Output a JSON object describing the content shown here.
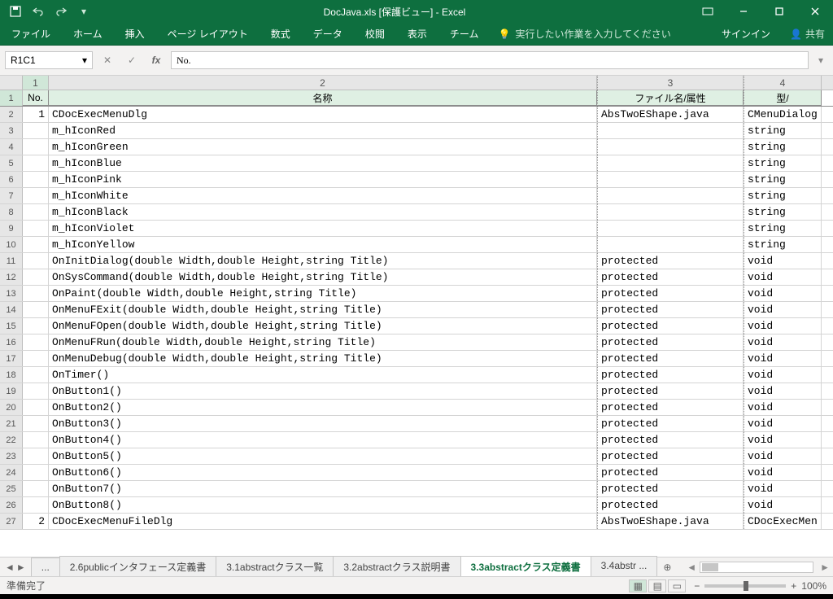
{
  "title": "DocJava.xls  [保護ビュー] - Excel",
  "qat": {
    "save": "💾"
  },
  "ribbon": [
    "ファイル",
    "ホーム",
    "挿入",
    "ページ レイアウト",
    "数式",
    "データ",
    "校閲",
    "表示",
    "チーム"
  ],
  "tellme": "実行したい作業を入力してください",
  "signin": "サインイン",
  "share": "共有",
  "namebox": "R1C1",
  "formula": "No.",
  "columns": [
    "1",
    "2",
    "3",
    "4"
  ],
  "headers": {
    "c1": "No.",
    "c2": "名称",
    "c3": "ファイル名/属性",
    "c4": "型/"
  },
  "rows": [
    {
      "n": "1",
      "name": "CDocExecMenuDlg",
      "attr": "AbsTwoEShape.java",
      "type": "CMenuDialog"
    },
    {
      "n": "",
      "name": "m_hIconRed",
      "attr": "",
      "type": "string"
    },
    {
      "n": "",
      "name": "m_hIconGreen",
      "attr": "",
      "type": "string"
    },
    {
      "n": "",
      "name": "m_hIconBlue",
      "attr": "",
      "type": "string"
    },
    {
      "n": "",
      "name": "m_hIconPink",
      "attr": "",
      "type": "string"
    },
    {
      "n": "",
      "name": "m_hIconWhite",
      "attr": "",
      "type": "string"
    },
    {
      "n": "",
      "name": "m_hIconBlack",
      "attr": "",
      "type": "string"
    },
    {
      "n": "",
      "name": "m_hIconViolet",
      "attr": "",
      "type": "string"
    },
    {
      "n": "",
      "name": "m_hIconYellow",
      "attr": "",
      "type": "string"
    },
    {
      "n": "",
      "name": "OnInitDialog(double Width,double Height,string Title)",
      "attr": "protected",
      "type": "void"
    },
    {
      "n": "",
      "name": "OnSysCommand(double Width,double Height,string Title)",
      "attr": "protected",
      "type": "void"
    },
    {
      "n": "",
      "name": "OnPaint(double Width,double Height,string Title)",
      "attr": "protected",
      "type": "void"
    },
    {
      "n": "",
      "name": "OnMenuFExit(double Width,double Height,string Title)",
      "attr": "protected",
      "type": "void"
    },
    {
      "n": "",
      "name": "OnMenuFOpen(double Width,double Height,string Title)",
      "attr": "protected",
      "type": "void"
    },
    {
      "n": "",
      "name": "OnMenuFRun(double Width,double Height,string Title)",
      "attr": "protected",
      "type": "void"
    },
    {
      "n": "",
      "name": "OnMenuDebug(double Width,double Height,string Title)",
      "attr": "protected",
      "type": "void"
    },
    {
      "n": "",
      "name": "OnTimer()",
      "attr": "protected",
      "type": "void"
    },
    {
      "n": "",
      "name": "OnButton1()",
      "attr": "protected",
      "type": "void"
    },
    {
      "n": "",
      "name": "OnButton2()",
      "attr": "protected",
      "type": "void"
    },
    {
      "n": "",
      "name": "OnButton3()",
      "attr": "protected",
      "type": "void"
    },
    {
      "n": "",
      "name": "OnButton4()",
      "attr": "protected",
      "type": "void"
    },
    {
      "n": "",
      "name": "OnButton5()",
      "attr": "protected",
      "type": "void"
    },
    {
      "n": "",
      "name": "OnButton6()",
      "attr": "protected",
      "type": "void"
    },
    {
      "n": "",
      "name": "OnButton7()",
      "attr": "protected",
      "type": "void"
    },
    {
      "n": "",
      "name": "OnButton8()",
      "attr": "protected",
      "type": "void"
    },
    {
      "n": "2",
      "name": "CDocExecMenuFileDlg",
      "attr": "AbsTwoEShape.java",
      "type": "CDocExecMen"
    }
  ],
  "sheets": {
    "ellipsis": "...",
    "tabs": [
      "2.6publicインタフェース定義書",
      "3.1abstractクラス一覧",
      "3.2abstractクラス説明書",
      "3.3abstractクラス定義書",
      "3.4abstr ..."
    ],
    "active": 3
  },
  "status": "準備完了",
  "zoom": "100%"
}
